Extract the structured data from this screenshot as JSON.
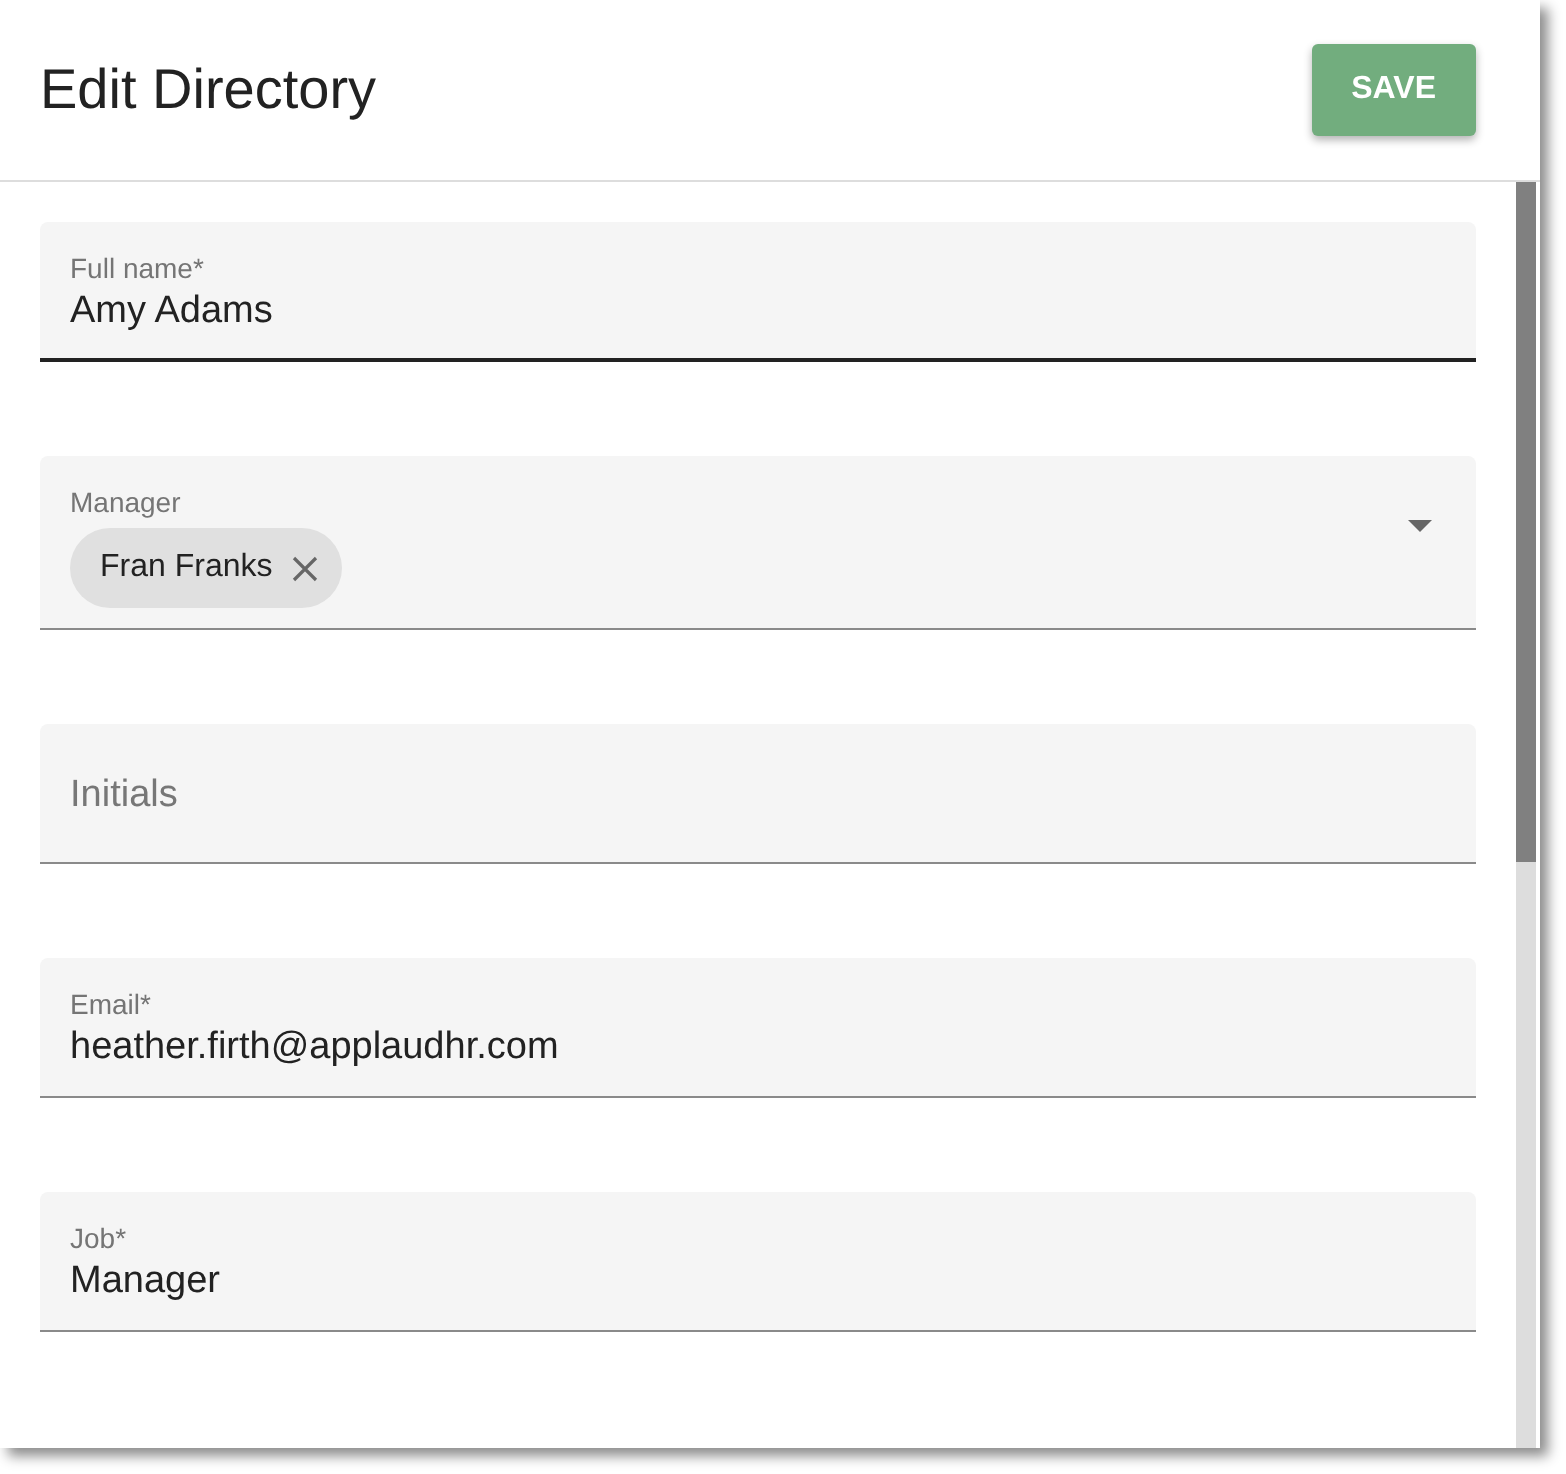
{
  "title": "Edit Directory",
  "save_button": "SAVE",
  "fields": [
    {
      "kind": "text",
      "label": "Full name*",
      "value": "Amy Adams",
      "focused": true
    },
    {
      "kind": "select",
      "label": "Manager",
      "chips": [
        "Fran Franks"
      ],
      "focused": false
    },
    {
      "kind": "text",
      "placeholder": "Initials",
      "focused": false
    },
    {
      "kind": "text",
      "label": "Email*",
      "value": "heather.firth@applaudhr.com",
      "focused": false
    },
    {
      "kind": "text",
      "label": "Job*",
      "value": "Manager",
      "focused": false
    }
  ]
}
